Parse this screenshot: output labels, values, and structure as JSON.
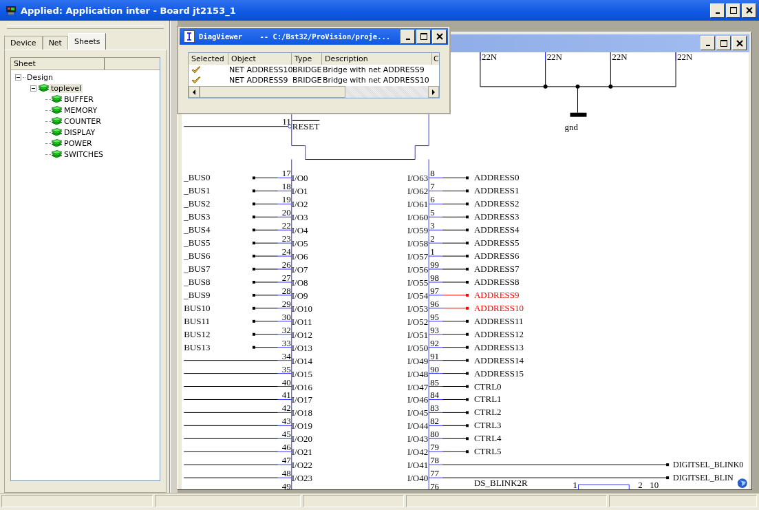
{
  "window": {
    "title": "Applied: Application inter - Board jt2153_1"
  },
  "left_panel": {
    "tabs": [
      {
        "label": "Device",
        "selected": false
      },
      {
        "label": "Net",
        "selected": false
      },
      {
        "label": "Sheets",
        "selected": true
      }
    ],
    "tree": {
      "column": "Sheet",
      "items": [
        {
          "label": "Design",
          "expanded": true,
          "selected": false,
          "children": [
            {
              "label": "toplevel",
              "expanded": true,
              "selected": true,
              "children": [
                {
                  "label": "BUFFER",
                  "selected": false
                },
                {
                  "label": "MEMORY",
                  "selected": false
                },
                {
                  "label": "COUNTER",
                  "selected": false
                },
                {
                  "label": "DISPLAY",
                  "selected": false
                },
                {
                  "label": "POWER",
                  "selected": false
                },
                {
                  "label": "SWITCHES",
                  "selected": false
                }
              ]
            }
          ]
        }
      ]
    }
  },
  "diag_viewer": {
    "title": "DiagViewer    -- C:/Bst32/ProVision/proje...",
    "columns": [
      "Selected",
      "Object",
      "Type",
      "Description",
      "C"
    ],
    "rows": [
      {
        "selected": true,
        "object": "NET ADDRESS10",
        "type": "BRIDGE",
        "description": "Bridge with net ADDRESS9"
      },
      {
        "selected": true,
        "object": "NET ADDRESS9",
        "type": "BRIDGE",
        "description": "Bridge with net ADDRESS10"
      }
    ]
  },
  "schematic": {
    "resistors": [
      "22N",
      "22N",
      "22N",
      "22N"
    ],
    "ground_label": "gnd",
    "reset_pin": {
      "number": "11",
      "name": "RESET"
    },
    "left_pins": [
      {
        "number": "17",
        "name": "I/O0",
        "net": "_BUS0"
      },
      {
        "number": "18",
        "name": "I/O1",
        "net": "_BUS1"
      },
      {
        "number": "19",
        "name": "I/O2",
        "net": "_BUS2"
      },
      {
        "number": "20",
        "name": "I/O3",
        "net": "_BUS3"
      },
      {
        "number": "22",
        "name": "I/O4",
        "net": "_BUS4"
      },
      {
        "number": "23",
        "name": "I/O5",
        "net": "_BUS5"
      },
      {
        "number": "24",
        "name": "I/O6",
        "net": "_BUS6"
      },
      {
        "number": "26",
        "name": "I/O7",
        "net": "_BUS7"
      },
      {
        "number": "27",
        "name": "I/O8",
        "net": "_BUS8"
      },
      {
        "number": "28",
        "name": "I/O9",
        "net": "_BUS9"
      },
      {
        "number": "29",
        "name": "I/O10",
        "net": "BUS10"
      },
      {
        "number": "30",
        "name": "I/O11",
        "net": "BUS11"
      },
      {
        "number": "32",
        "name": "I/O12",
        "net": "BUS12"
      },
      {
        "number": "33",
        "name": "I/O13",
        "net": "BUS13"
      },
      {
        "number": "34",
        "name": "I/O14"
      },
      {
        "number": "35",
        "name": "I/O15"
      },
      {
        "number": "40",
        "name": "I/O16"
      },
      {
        "number": "41",
        "name": "I/O17"
      },
      {
        "number": "42",
        "name": "I/O18"
      },
      {
        "number": "43",
        "name": "I/O19"
      },
      {
        "number": "45",
        "name": "I/O20"
      },
      {
        "number": "46",
        "name": "I/O21"
      },
      {
        "number": "47",
        "name": "I/O22"
      },
      {
        "number": "48",
        "name": "I/O23"
      },
      {
        "number": "49"
      }
    ],
    "right_pins": [
      {
        "number": "8",
        "name": "I/O63",
        "net": "ADDRESS0",
        "kind": "local",
        "highlighted": false
      },
      {
        "number": "7",
        "name": "I/O62",
        "net": "ADDRESS1",
        "kind": "local",
        "highlighted": false
      },
      {
        "number": "6",
        "name": "I/O61",
        "net": "ADDRESS2",
        "kind": "local",
        "highlighted": false
      },
      {
        "number": "5",
        "name": "I/O60",
        "net": "ADDRESS3",
        "kind": "local",
        "highlighted": false
      },
      {
        "number": "3",
        "name": "I/O59",
        "net": "ADDRESS4",
        "kind": "local",
        "highlighted": false
      },
      {
        "number": "2",
        "name": "I/O58",
        "net": "ADDRESS5",
        "kind": "local",
        "highlighted": false
      },
      {
        "number": "1",
        "name": "I/O57",
        "net": "ADDRESS6",
        "kind": "local",
        "highlighted": false
      },
      {
        "number": "99",
        "name": "I/O56",
        "net": "ADDRESS7",
        "kind": "local",
        "highlighted": false
      },
      {
        "number": "98",
        "name": "I/O55",
        "net": "ADDRESS8",
        "kind": "local",
        "highlighted": false
      },
      {
        "number": "97",
        "name": "I/O54",
        "net": "ADDRESS9",
        "kind": "local",
        "highlighted": true
      },
      {
        "number": "96",
        "name": "I/O53",
        "net": "ADDRESS10",
        "kind": "local",
        "highlighted": true
      },
      {
        "number": "95",
        "name": "I/O52",
        "net": "ADDRESS11",
        "kind": "local",
        "highlighted": false
      },
      {
        "number": "93",
        "name": "I/O51",
        "net": "ADDRESS12",
        "kind": "local",
        "highlighted": false
      },
      {
        "number": "92",
        "name": "I/O50",
        "net": "ADDRESS13",
        "kind": "local",
        "highlighted": false
      },
      {
        "number": "91",
        "name": "I/O49",
        "net": "ADDRESS14",
        "kind": "local",
        "highlighted": false
      },
      {
        "number": "90",
        "name": "I/O48",
        "net": "ADDRESS15",
        "kind": "local",
        "highlighted": false
      },
      {
        "number": "85",
        "name": "I/O47",
        "net": "CTRL0",
        "kind": "local",
        "highlighted": false
      },
      {
        "number": "84",
        "name": "I/O46",
        "net": "CTRL1",
        "kind": "local",
        "highlighted": false
      },
      {
        "number": "83",
        "name": "I/O45",
        "net": "CTRL2",
        "kind": "local",
        "highlighted": false
      },
      {
        "number": "82",
        "name": "I/O44",
        "net": "CTRL3",
        "kind": "local",
        "highlighted": false
      },
      {
        "number": "80",
        "name": "I/O43",
        "net": "CTRL4",
        "kind": "local",
        "highlighted": false
      },
      {
        "number": "79",
        "name": "I/O42",
        "net": "CTRL5",
        "kind": "local",
        "highlighted": false
      },
      {
        "number": "78",
        "name": "I/O41",
        "net": "DIGITSEL_BLINK0",
        "kind": "long",
        "highlighted": false
      },
      {
        "number": "77",
        "name": "I/O40",
        "net": "DIGITSEL_BLIN",
        "kind": "long",
        "highlighted": false
      },
      {
        "number": "76"
      }
    ],
    "net_label": "DS_BLINK2R",
    "part_pins": [
      "1",
      "2",
      "10"
    ]
  }
}
